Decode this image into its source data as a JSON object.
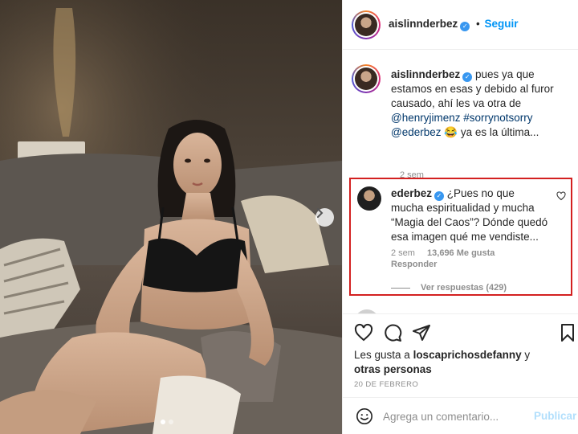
{
  "post": {
    "author": "aislinnderbez",
    "follow_label": "Seguir",
    "bullet": "•",
    "verified_mark": "✓"
  },
  "caption": {
    "username": "aislinnderbez",
    "text_before": " pues ya que estamos en esas y debido al furor causado, ahí les va otra de ",
    "mention_1": "@henryjimenz",
    "hashtag": "#sorrynotsorry",
    "mention_2": "@ederbez",
    "emoji": "😂",
    "text_after": " ya es la última...",
    "time": "2 sem"
  },
  "highlighted_comment": {
    "username": "ederbez",
    "text": " ¿Pues no que mucha espiritualidad y mucha “Magia del Caos”? Dónde quedó esa imagen qué me vendiste...",
    "time": "2 sem",
    "likes": "13,696 Me gusta",
    "reply_label": "Responder",
    "view_replies": "Ver respuestas (429)",
    "highlight_color": "#d32020"
  },
  "likes_line": {
    "prefix": "Les gusta a ",
    "user": "loscaprichosdefanny",
    "connector": " y",
    "others": "otras personas"
  },
  "date": "20 DE FEBRERO",
  "add_comment": {
    "placeholder": "Agrega un comentario...",
    "publish_label": "Publicar"
  },
  "icons": [
    "heart-icon",
    "comment-icon",
    "share-icon",
    "bookmark-icon",
    "emoji-icon",
    "chevron-right-icon",
    "verified-icon"
  ],
  "carousel": {
    "total": 2,
    "active": 1
  },
  "colors": {
    "accent": "#0095f6",
    "publish_disabled": "#b2dffc",
    "muted": "#8e8e8e",
    "link": "#00376b"
  }
}
